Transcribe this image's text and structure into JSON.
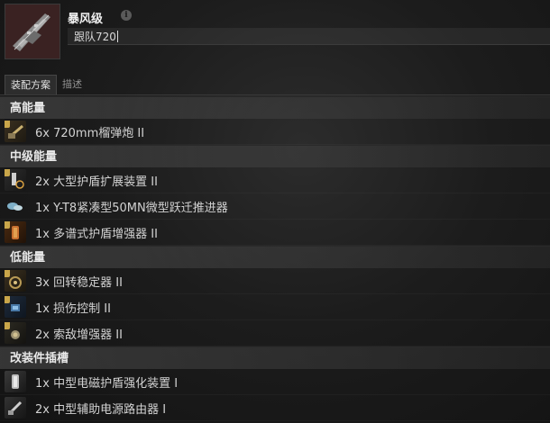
{
  "header": {
    "title": "暴风级",
    "fit_name": "跟队720",
    "info_icon": "info-icon",
    "ship_icon": "ship-thumbnail"
  },
  "tabs": [
    {
      "label": "装配方案",
      "active": true
    },
    {
      "label": "描述",
      "active": false
    }
  ],
  "sections": [
    {
      "label": "高能量",
      "items": [
        {
          "text": "6x 720mm榴弹炮 II",
          "icon": "artillery-icon",
          "color": "#8a7a55"
        }
      ]
    },
    {
      "label": "中级能量",
      "items": [
        {
          "text": "2x 大型护盾扩展装置 II",
          "icon": "shield-extender-icon",
          "color": "#6d6d6d"
        },
        {
          "text": "1x Y-T8紧凑型50MN微型跃迁推进器",
          "icon": "microwarpdrive-icon",
          "color": "#5a7a8a"
        },
        {
          "text": "1x 多谱式护盾增强器 II",
          "icon": "shield-hardener-icon",
          "color": "#8a5a2a"
        }
      ]
    },
    {
      "label": "低能量",
      "items": [
        {
          "text": "3x 回转稳定器 II",
          "icon": "gyrostabilizer-icon",
          "color": "#7a6a45"
        },
        {
          "text": "1x 损伤控制 II",
          "icon": "damage-control-icon",
          "color": "#3a5a7a"
        },
        {
          "text": "2x 索敌增强器 II",
          "icon": "signal-amplifier-icon",
          "color": "#6a6a6a"
        }
      ]
    },
    {
      "label": "改装件插槽",
      "items": [
        {
          "text": "1x 中型电磁护盾强化装置 I",
          "icon": "rig-icon",
          "color": "#6a6a6a"
        },
        {
          "text": "2x 中型辅助电源路由器 I",
          "icon": "rig-icon",
          "color": "#5a5a5a"
        }
      ]
    }
  ]
}
